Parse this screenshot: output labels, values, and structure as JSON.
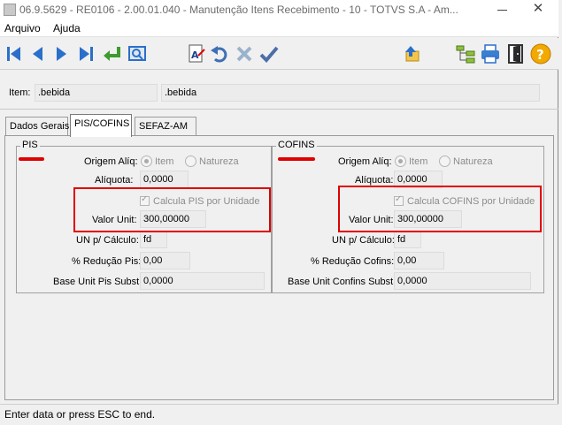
{
  "window": {
    "title": "06.9.5629 - RE0106 - 2.00.01.040 - Manutenção Itens Recebimento - 10 - TOTVS S.A - Am...",
    "close_symbol": "✕"
  },
  "menu": {
    "items": [
      "Arquivo",
      "Ajuda"
    ]
  },
  "toolbar": {
    "buttons": [
      "first-record-icon",
      "previous-record-icon",
      "next-record-icon",
      "last-record-icon",
      "go-to-icon",
      "search-icon",
      "text-edit-icon",
      "undo-icon",
      "delete-icon",
      "confirm-icon",
      "up-folder-icon",
      "hierarchy-icon",
      "print-icon",
      "exit-icon",
      "help-icon"
    ]
  },
  "item": {
    "label": "Item:",
    "code": ".bebida",
    "description": ".bebida"
  },
  "tabs": [
    {
      "label": "Dados Gerais",
      "active": false
    },
    {
      "label": "PIS/COFINS",
      "active": true
    },
    {
      "label": "SEFAZ-AM",
      "active": false
    }
  ],
  "pis": {
    "group_title": "PIS",
    "origem_label": "Origem Alíq:",
    "origem_options": [
      "Item",
      "Natureza"
    ],
    "aliquota_label": "Alíquota:",
    "aliquota_value": "0,0000",
    "calcula_label": "Calcula PIS por Unidade",
    "valor_unit_label": "Valor Unit:",
    "valor_unit_value": "300,00000",
    "un_calculo_label": "UN p/ Cálculo:",
    "un_calculo_value": "fd",
    "reducao_label": "% Redução Pis:",
    "reducao_value": "0,00",
    "base_unit_label": "Base Unit Pis Subst:",
    "base_unit_value": "0,0000"
  },
  "cofins": {
    "group_title": "COFINS",
    "origem_label": "Origem Alíq:",
    "origem_options": [
      "Item",
      "Natureza"
    ],
    "aliquota_label": "Alíquota:",
    "aliquota_value": "0,0000",
    "calcula_label": "Calcula COFINS por Unidade",
    "valor_unit_label": "Valor Unit:",
    "valor_unit_value": "300,00000",
    "un_calculo_label": "UN p/ Cálculo:",
    "un_calculo_value": "fd",
    "reducao_label": "% Redução Cofins:",
    "reducao_value": "0,00",
    "base_unit_label": "Base Unit Confins Subst:",
    "base_unit_value": "0,0000"
  },
  "status": {
    "text": "Enter data or press ESC to end."
  },
  "colors": {
    "highlight": "#e00000",
    "icon_blue": "#2a6fc9",
    "icon_green": "#3d9b2f"
  }
}
